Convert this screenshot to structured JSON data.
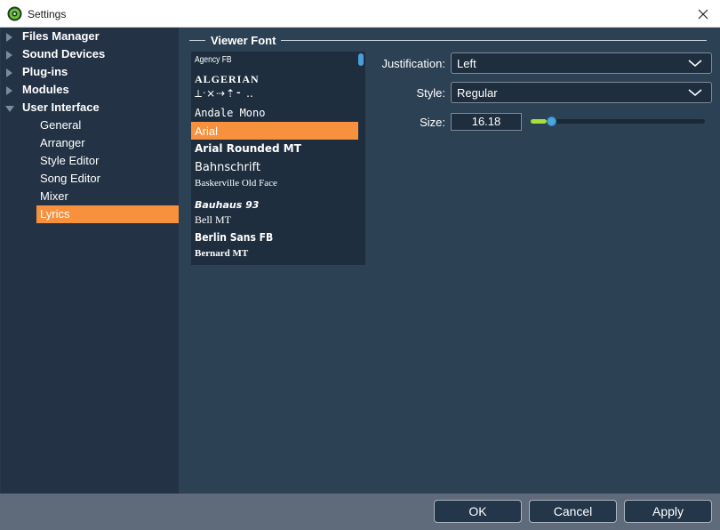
{
  "window": {
    "title": "Settings",
    "close_icon": "close-icon"
  },
  "sidebar": {
    "items": [
      {
        "label": "Files Manager",
        "expanded": false
      },
      {
        "label": "Sound Devices",
        "expanded": false
      },
      {
        "label": "Plug-ins",
        "expanded": false
      },
      {
        "label": "Modules",
        "expanded": false
      },
      {
        "label": "User Interface",
        "expanded": true
      }
    ],
    "subitems": [
      "General",
      "Arranger",
      "Style Editor",
      "Song Editor",
      "Mixer",
      "Lyrics"
    ],
    "selected": "Lyrics"
  },
  "viewer_font": {
    "group_title": "Viewer Font",
    "fonts": [
      "Agency FB",
      "ALGERIAN",
      "⟂ᐧ⨯⇢⇡⁃ ‥",
      "Andale Mono",
      "Arial",
      "Arial Rounded MT",
      "Bahnschrift",
      "Baskerville Old Face",
      "Bauhaus 93",
      "Bell MT",
      "Berlin Sans FB",
      "Bernard MT"
    ],
    "selected_font": "Arial",
    "justification_label": "Justification:",
    "justification_value": "Left",
    "style_label": "Style:",
    "style_value": "Regular",
    "size_label": "Size:",
    "size_value": "16.18",
    "size_slider_fraction": 0.07
  },
  "footer": {
    "ok_label": "OK",
    "cancel_label": "Cancel",
    "apply_label": "Apply"
  },
  "colors": {
    "accent": "#f7913d",
    "slider_fill": "#a4e13a",
    "slider_thumb": "#4aa6df"
  }
}
